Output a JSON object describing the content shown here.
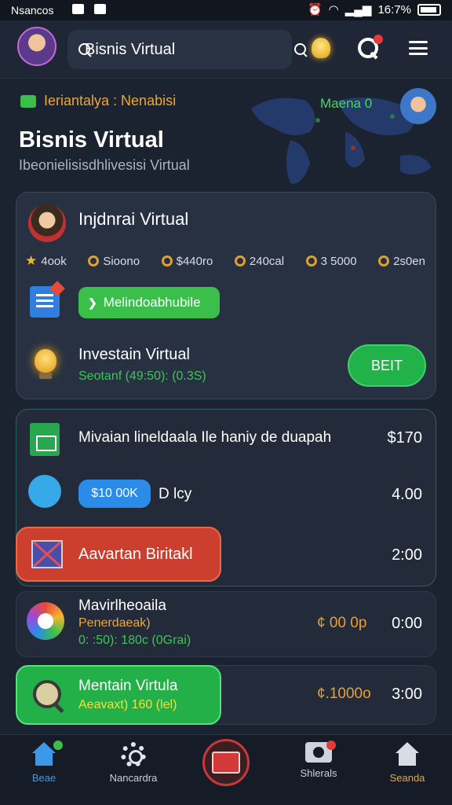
{
  "status_bar": {
    "left_text": "Nsancos",
    "right_text": "16:7%"
  },
  "header": {
    "search_value": "Bisnis Virtual",
    "search_placeholder": "Bisnis Virtual"
  },
  "hero": {
    "tag": "Ieriantalya : Nenabisi",
    "title": "Bisnis Virtual",
    "subtitle": "Ibeonielisisdhlivesisi Virtual",
    "right_label": "Maena 0"
  },
  "card1": {
    "title": "Injdnrai Virtual",
    "stats": [
      "4ook",
      "Sioono",
      "$440ro",
      "240cal",
      "3 5000",
      "2s0en"
    ],
    "pill_label": "Melindoabhubile",
    "invest_title": "Investain Virtual",
    "invest_sub": "Seotanf (49:50): (0.3S)",
    "buy_button": "BEIT"
  },
  "list": {
    "row1_text": "Mivaian lineldaala Ile haniy de duapah",
    "row1_value": "$170",
    "row2_pill": "$10 00K",
    "row2_text": "D lcy",
    "row2_value": "4.00",
    "row3_button": "Aavartan Biritakl",
    "row3_value": "2:00",
    "row4_title": "Mavirlheoaila",
    "row4_sub1": "Penerdaeak)",
    "row4_sub2": "0: :50): 180c (0Grai)",
    "row4_gold": "¢ 00 0p",
    "row4_value": "0:00",
    "row5_title": "Mentain Virtula",
    "row5_sub": "Aeavaxt) 160 (lel)",
    "row5_gold": "¢.1000o",
    "row5_value": "3:00"
  },
  "bottom_nav": {
    "item1": "Beae",
    "item2": "Nancardra",
    "item4": "Shlerals",
    "item5": "Seanda"
  },
  "colors": {
    "accent_green": "#3bbf4b",
    "accent_orange": "#e8a83a",
    "danger_red": "#cc3f2f",
    "background": "#1b2230"
  }
}
